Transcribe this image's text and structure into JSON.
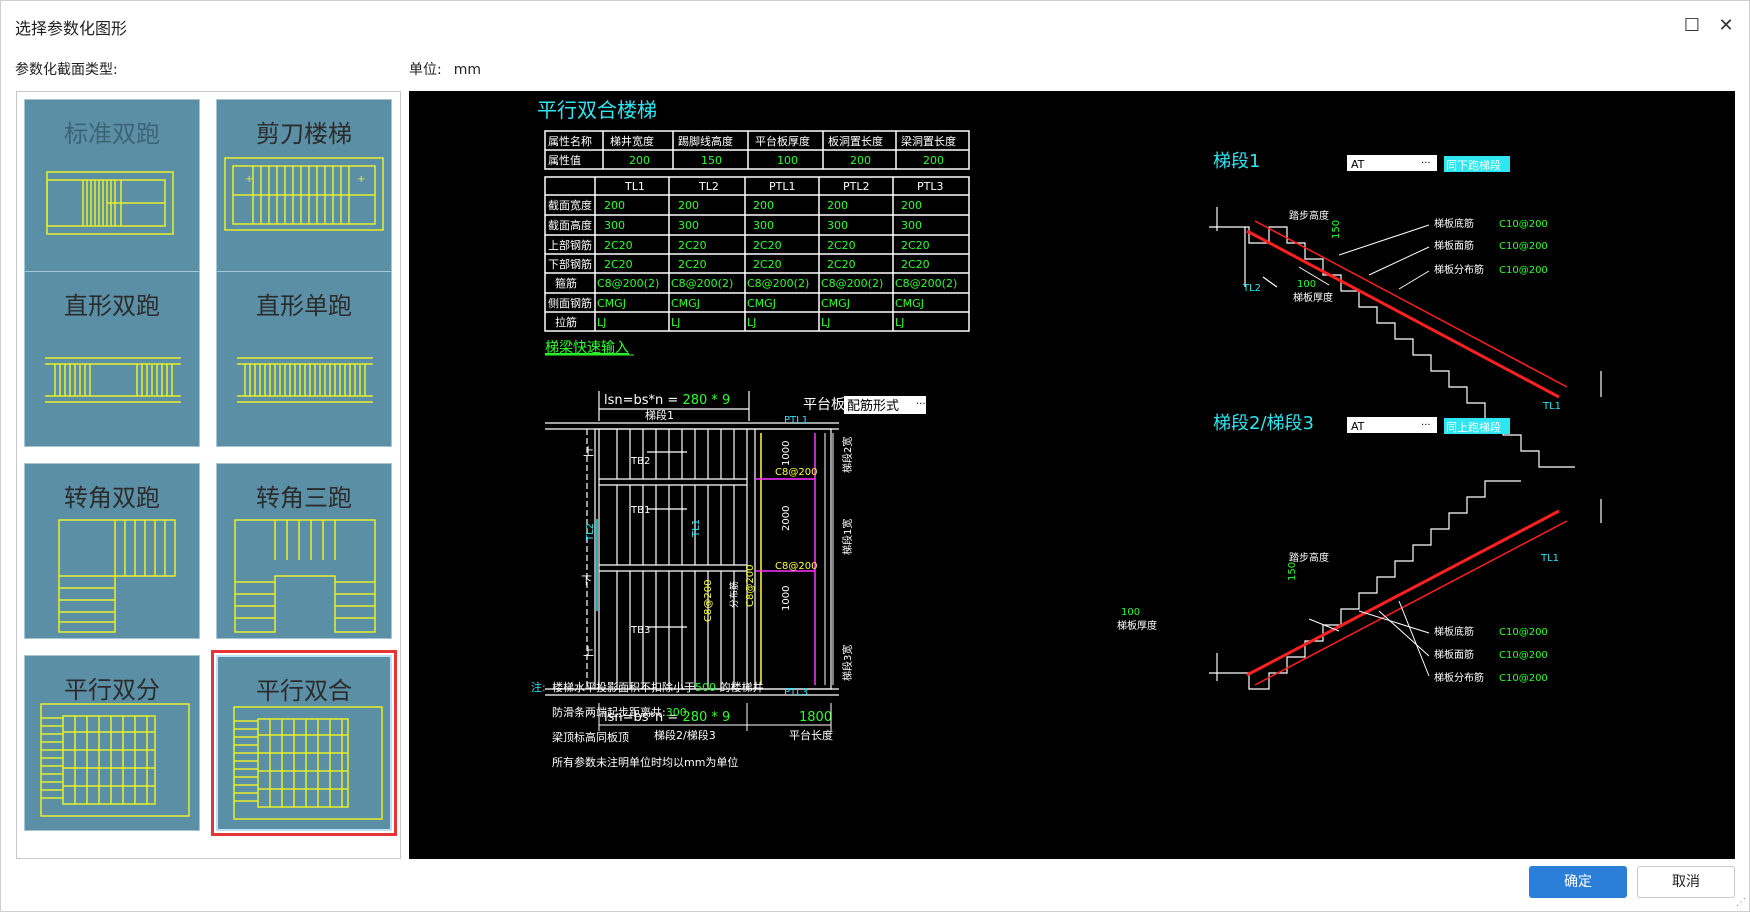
{
  "window": {
    "title": "选择参数化图形",
    "maximize_glyph": "☐",
    "close_glyph": "✕"
  },
  "labels": {
    "section_type": "参数化截面类型:",
    "unit_label": "单位:",
    "unit_value": "mm"
  },
  "tiles": [
    {
      "label": "标准双跑",
      "selected": false
    },
    {
      "label": "剪刀楼梯",
      "selected": false
    },
    {
      "label": "直形双跑",
      "selected": false
    },
    {
      "label": "直形单跑",
      "selected": false
    },
    {
      "label": "转角双跑",
      "selected": false
    },
    {
      "label": "转角三跑",
      "selected": false
    },
    {
      "label": "平行双分",
      "selected": false
    },
    {
      "label": "平行双合",
      "selected": true
    }
  ],
  "preview": {
    "title": "平行双合楼梯",
    "attr_table": {
      "headers": [
        "属性名称",
        "梯井宽度",
        "踢脚线高度",
        "平台板厚度",
        "板洞置长度",
        "梁洞置长度"
      ],
      "row_label": "属性值",
      "values": [
        "200",
        "150",
        "100",
        "200",
        "200"
      ]
    },
    "beam_table": {
      "columns": [
        "TL1",
        "TL2",
        "PTL1",
        "PTL2",
        "PTL3"
      ],
      "rows": [
        {
          "label": "截面宽度",
          "values": [
            "200",
            "200",
            "200",
            "200",
            "200"
          ]
        },
        {
          "label": "截面高度",
          "values": [
            "300",
            "300",
            "300",
            "300",
            "300"
          ]
        },
        {
          "label": "上部钢筋",
          "values": [
            "2C20",
            "2C20",
            "2C20",
            "2C20",
            "2C20"
          ]
        },
        {
          "label": "下部钢筋",
          "values": [
            "2C20",
            "2C20",
            "2C20",
            "2C20",
            "2C20"
          ]
        },
        {
          "label": "箍筋",
          "values": [
            "C8@200(2)",
            "C8@200(2)",
            "C8@200(2)",
            "C8@200(2)",
            "C8@200(2)"
          ]
        },
        {
          "label": "侧面钢筋",
          "values": [
            "CMGJ",
            "CMGJ",
            "CMGJ",
            "CMGJ",
            "CMGJ"
          ]
        },
        {
          "label": "拉筋",
          "values": [
            "LJ",
            "LJ",
            "LJ",
            "LJ",
            "LJ"
          ]
        }
      ]
    },
    "quick_input_link": "梯梁快速输入",
    "plan": {
      "top_formula_prefix": "lsn=bs*n = ",
      "top_formula_value": "280 * 9",
      "top_segment": "梯段1",
      "platform_label": "平台板:",
      "platform_value": "配筋形式",
      "platform_btn": "···",
      "labels_tb": [
        "TB2",
        "TB1",
        "TB3"
      ],
      "up_down": [
        "上",
        "下",
        "上"
      ],
      "ptl_top": "PTL1",
      "ptl_bottom": "PTL3",
      "rebar": [
        "C8@200",
        "C8@200",
        "C8@200",
        "C8@200"
      ],
      "side_dims": [
        "1000",
        "2000",
        "1000"
      ],
      "side_labels": [
        "梯段2宽",
        "梯段1宽",
        "梯段3宽"
      ],
      "tl1": "TL1",
      "tl2": "TL2",
      "dir_label": "分布筋",
      "bottom_formula_prefix": "lsn=bs*n = ",
      "bottom_formula_value": "280 * 9",
      "bottom_segment": "梯段2/梯段3",
      "platform_len_value": "1800",
      "platform_len_label": "平台长度"
    },
    "notes": {
      "prefix": "注:",
      "lines": [
        {
          "text": "楼梯水平投影面积不扣除小于",
          "value": "500",
          "tail": " 的楼梯井"
        },
        {
          "text": "防滑条两端起步距离共:",
          "value": "300",
          "tail": ""
        },
        {
          "text": "梁顶标高同板顶",
          "value": "",
          "tail": ""
        },
        {
          "text": "所有参数未注明单位时均以mm为单位",
          "value": "",
          "tail": ""
        }
      ]
    },
    "seg1": {
      "title": "梯段1",
      "type_value": "AT",
      "btn": "···",
      "link": "同下跑梯段",
      "labels": [
        "踏步高度",
        "150",
        "100",
        "梯板厚度",
        "梯板底筋",
        "C10@200",
        "梯板面筋",
        "C10@200",
        "梯板分布筋",
        "C10@200",
        "TL2",
        "TL1"
      ]
    },
    "seg23": {
      "title": "梯段2/梯段3",
      "type_value": "AT",
      "btn": "···",
      "link": "同上跑梯段",
      "labels": [
        "踏步高度",
        "150",
        "100",
        "梯板厚度",
        "梯板底筋",
        "C10@200",
        "梯板面筋",
        "C10@200",
        "梯板分布筋",
        "C10@200",
        "TL1"
      ]
    }
  },
  "buttons": {
    "ok": "确定",
    "cancel": "取消"
  },
  "colors": {
    "cad_white": "#ffffff",
    "cad_green": "#2bff2b",
    "cad_cyan": "#2ee6f0",
    "cad_yellow": "#ffff33",
    "cad_red": "#ff2020",
    "cad_magenta": "#ff33ff",
    "tile_bg": "#5b8fa6"
  }
}
